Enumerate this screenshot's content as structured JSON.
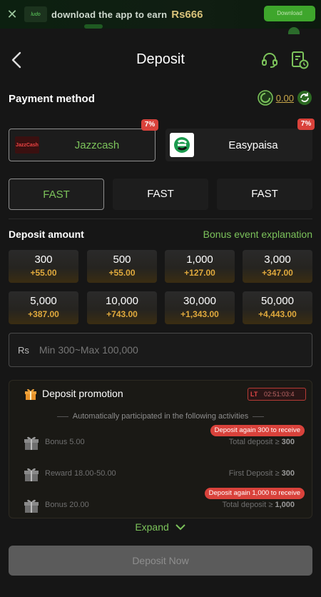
{
  "banner": {
    "close_icon": "close-icon",
    "text": "download the app to earn",
    "amount": "Rs666",
    "download_label": "Download"
  },
  "header": {
    "title": "Deposit",
    "back_icon": "chevron-left-icon",
    "support_icon": "headset-icon",
    "history_icon": "record-clock-icon"
  },
  "payment": {
    "title": "Payment method",
    "balance": "0.00",
    "methods": [
      {
        "name": "Jazzcash",
        "badge": "7%",
        "logo_text": "JazzCash",
        "selected": true
      },
      {
        "name": "Easypaisa",
        "badge": "7%",
        "selected": false
      }
    ],
    "channels": [
      "FAST",
      "FAST",
      "FAST"
    ]
  },
  "deposit": {
    "title": "Deposit amount",
    "bonus_link": "Bonus event explanation",
    "amounts": [
      {
        "amount": "300",
        "bonus": "+55.00"
      },
      {
        "amount": "500",
        "bonus": "+55.00"
      },
      {
        "amount": "1,000",
        "bonus": "+127.00"
      },
      {
        "amount": "3,000",
        "bonus": "+347.00"
      },
      {
        "amount": "5,000",
        "bonus": "+387.00"
      },
      {
        "amount": "10,000",
        "bonus": "+743.00"
      },
      {
        "amount": "30,000",
        "bonus": "+1,343.00"
      },
      {
        "amount": "50,000",
        "bonus": "+4,443.00"
      }
    ],
    "currency": "Rs",
    "placeholder": "Min 300~Max 100,000"
  },
  "promotion": {
    "title": "Deposit promotion",
    "timer_tag": "LT",
    "timer": "02:51:03:4",
    "subtitle": "Automatically participated in the following activities",
    "rows": [
      {
        "label": "Bonus 5.00",
        "requirement": "Total deposit ≥",
        "value": "300",
        "tag": "Deposit again 300 to receive"
      },
      {
        "label": "Reward 18.00-50.00",
        "requirement": "First Deposit ≥",
        "value": "300",
        "tag": ""
      },
      {
        "label": "Bonus 20.00",
        "requirement": "Total deposit ≥",
        "value": "1,000",
        "tag": "Deposit again 1,000 to receive"
      }
    ],
    "expand_label": "Expand"
  },
  "action": {
    "deposit_now": "Deposit Now"
  },
  "colors": {
    "accent_green": "#7cc35b",
    "gold": "#e0a93c",
    "badge_red": "#d9423b",
    "background": "#161616"
  }
}
